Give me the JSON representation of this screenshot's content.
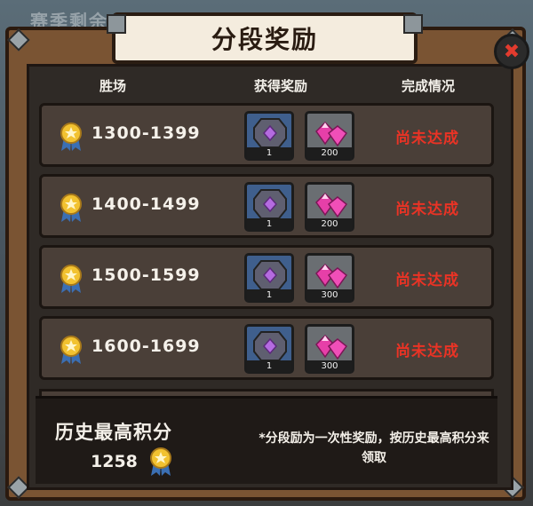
{
  "background": {
    "faded_text": "赛季剩余"
  },
  "title": "分段奖励",
  "close_icon": "close-icon",
  "headers": {
    "wins": "胜场",
    "rewards": "获得奖励",
    "status": "完成情况"
  },
  "rows": [
    {
      "range": "1300-1399",
      "reward_box_count": "1",
      "reward_gem_count": "200",
      "status": "尚未达成"
    },
    {
      "range": "1400-1499",
      "reward_box_count": "1",
      "reward_gem_count": "200",
      "status": "尚未达成"
    },
    {
      "range": "1500-1599",
      "reward_box_count": "1",
      "reward_gem_count": "300",
      "status": "尚未达成"
    },
    {
      "range": "1600-1699",
      "reward_box_count": "1",
      "reward_gem_count": "300",
      "status": "尚未达成"
    }
  ],
  "bottom": {
    "history_label": "历史最高积分",
    "history_score": "1258",
    "note": "*分段励为一次性奖励，按历史最高积分来领取"
  },
  "colors": {
    "status_red": "#ea3325",
    "frame_brown": "#7a5433",
    "row_bg": "#4a3f38"
  }
}
